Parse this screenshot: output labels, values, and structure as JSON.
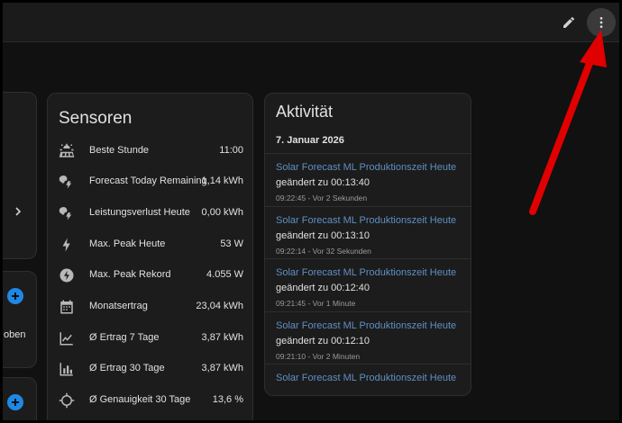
{
  "topbar": {
    "edit_icon": "pencil-icon",
    "menu_icon": "dots-vertical-icon"
  },
  "left_column": {
    "partial_text": "oben",
    "chevron_icon": "chevron-right-icon",
    "add_icon": "plus-circle-icon"
  },
  "sensors": {
    "title": "Sensoren",
    "rows": [
      {
        "icon": "solar-panel-icon",
        "label": "Beste Stunde",
        "value": "11:00"
      },
      {
        "icon": "weather-partly-lightning-icon",
        "label": "Forecast Today Remaining",
        "value": "1,14 kWh"
      },
      {
        "icon": "weather-partly-lightning-icon",
        "label": "Leistungsverlust Heute",
        "value": "0,00 kWh"
      },
      {
        "icon": "flash-icon",
        "label": "Max. Peak Heute",
        "value": "53 W"
      },
      {
        "icon": "flash-circle-icon",
        "label": "Max. Peak Rekord",
        "value": "4.055 W"
      },
      {
        "icon": "calendar-icon",
        "label": "Monatsertrag",
        "value": "23,04 kWh"
      },
      {
        "icon": "chart-line-icon",
        "label": "Ø Ertrag 7 Tage",
        "value": "3,87 kWh"
      },
      {
        "icon": "chart-bar-icon",
        "label": "Ø Ertrag 30 Tage",
        "value": "3,87 kWh"
      },
      {
        "icon": "crosshairs-icon",
        "label": "Ø Genauigkeit 30 Tage",
        "value": "13,6 %"
      }
    ]
  },
  "activity": {
    "title": "Aktivität",
    "date": "7. Januar 2026",
    "entries": [
      {
        "name": "Solar Forecast ML Produktionszeit Heute",
        "change": "geändert zu 00:13:40",
        "time": "09:22:45 - Vor 2 Sekunden"
      },
      {
        "name": "Solar Forecast ML Produktionszeit Heute",
        "change": "geändert zu 00:13:10",
        "time": "09:22:14 - Vor 32 Sekunden"
      },
      {
        "name": "Solar Forecast ML Produktionszeit Heute",
        "change": "geändert zu 00:12:40",
        "time": "09:21:45 - Vor 1 Minute"
      },
      {
        "name": "Solar Forecast ML Produktionszeit Heute",
        "change": "geändert zu 00:12:10",
        "time": "09:21:10 - Vor 2 Minuten"
      },
      {
        "name": "Solar Forecast ML Produktionszeit Heute",
        "change": "",
        "time": ""
      }
    ]
  },
  "colors": {
    "background": "#111111",
    "card": "#1c1c1c",
    "link": "#5e8fc4",
    "accent_blue": "#1e88e5",
    "arrow_red": "#e00000"
  }
}
